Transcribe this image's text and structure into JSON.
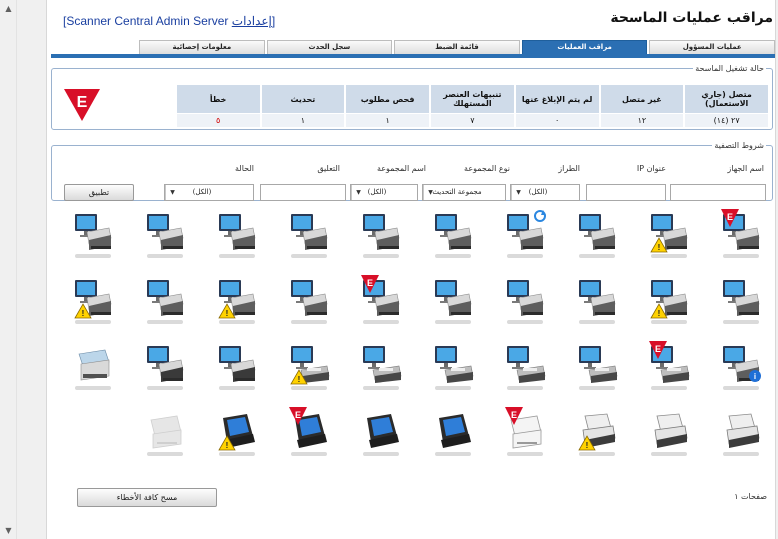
{
  "header": {
    "title": "مراقب عمليات الماسحة",
    "server_open": "[",
    "settings_link": "إعدادات",
    "server_name": "Scanner Central Admin Server",
    "server_close": "]"
  },
  "tabs": [
    {
      "label": "عمليات المسؤول",
      "active": false
    },
    {
      "label": "مراقب العمليات",
      "active": true
    },
    {
      "label": "قائمة الضبط",
      "active": false
    },
    {
      "label": "سجل الحدث",
      "active": false
    },
    {
      "label": "معلومات إحصائية",
      "active": false
    }
  ],
  "status": {
    "legend": "حالة تشغيل الماسحة",
    "headers": [
      "متصل (جاري الاستعمال)",
      "غير متصل",
      "لم يتم الإبلاغ عنها",
      "تنبيهات العنصر المستهلك",
      "فحص مطلوب",
      "تحديث",
      "خطأ"
    ],
    "values": [
      "٢٧ (١٤)",
      "١٢",
      "٠",
      "٧",
      "١",
      "١",
      "٥"
    ],
    "error_color": "#d00000"
  },
  "filter": {
    "legend": "شروط التصفية",
    "labels": {
      "device_name": "اسم الجهاز",
      "ip": "عنوان IP",
      "model": "الطراز",
      "group_type": "نوع المجموعة",
      "group_name": "اسم المجموعة",
      "comment": "التعليق",
      "status": "الحالة"
    },
    "values": {
      "model": "(الكل)",
      "group_type": "مجموعة التحديث",
      "group_name": "(الكل)",
      "status": "(الكل)"
    },
    "apply_label": "تطبيق"
  },
  "devices": [
    {
      "kind": "monitor-scanner",
      "badge": "none"
    },
    {
      "kind": "monitor-scanner",
      "badge": "none"
    },
    {
      "kind": "monitor-scanner",
      "badge": "none"
    },
    {
      "kind": "monitor-scanner",
      "badge": "none"
    },
    {
      "kind": "monitor-scanner",
      "badge": "none"
    },
    {
      "kind": "monitor-scanner",
      "badge": "none"
    },
    {
      "kind": "monitor-scanner",
      "badge": "update"
    },
    {
      "kind": "monitor-scanner",
      "badge": "none"
    },
    {
      "kind": "monitor-scanner",
      "badge": "warning"
    },
    {
      "kind": "monitor-scanner",
      "badge": "error"
    },
    {
      "kind": "monitor-scanner",
      "badge": "warning"
    },
    {
      "kind": "monitor-scanner",
      "badge": "none"
    },
    {
      "kind": "monitor-scanner",
      "badge": "warning"
    },
    {
      "kind": "monitor-scanner",
      "badge": "none"
    },
    {
      "kind": "monitor-scanner",
      "badge": "error"
    },
    {
      "kind": "monitor-scanner",
      "badge": "none"
    },
    {
      "kind": "monitor-scanner",
      "badge": "none"
    },
    {
      "kind": "monitor-scanner",
      "badge": "none"
    },
    {
      "kind": "monitor-scanner",
      "badge": "warning"
    },
    {
      "kind": "monitor-scanner",
      "badge": "none"
    },
    {
      "kind": "kiosk-scanner",
      "badge": "none"
    },
    {
      "kind": "monitor-scanner-dark",
      "badge": "none"
    },
    {
      "kind": "monitor-scanner-dark",
      "badge": "none"
    },
    {
      "kind": "monitor-flatbed",
      "badge": "warning"
    },
    {
      "kind": "monitor-flatbed",
      "badge": "none"
    },
    {
      "kind": "monitor-flatbed",
      "badge": "none"
    },
    {
      "kind": "monitor-flatbed",
      "badge": "none"
    },
    {
      "kind": "monitor-flatbed",
      "badge": "none"
    },
    {
      "kind": "monitor-flatbed",
      "badge": "error"
    },
    {
      "kind": "monitor-scanner",
      "badge": "info"
    },
    {
      "kind": "empty",
      "badge": "none"
    },
    {
      "kind": "white-scanner-offline",
      "badge": "none"
    },
    {
      "kind": "network-scanner",
      "badge": "warning"
    },
    {
      "kind": "network-scanner",
      "badge": "error"
    },
    {
      "kind": "network-scanner",
      "badge": "none"
    },
    {
      "kind": "network-scanner",
      "badge": "none"
    },
    {
      "kind": "white-scanner",
      "badge": "error"
    },
    {
      "kind": "white-scanner-dark",
      "badge": "warning"
    },
    {
      "kind": "white-scanner-dark",
      "badge": "none"
    },
    {
      "kind": "white-scanner-dark",
      "badge": "none"
    }
  ],
  "footer": {
    "clear_errors_label": "مسح كافة الأخطاء",
    "pages_label": "صفحات ١"
  }
}
